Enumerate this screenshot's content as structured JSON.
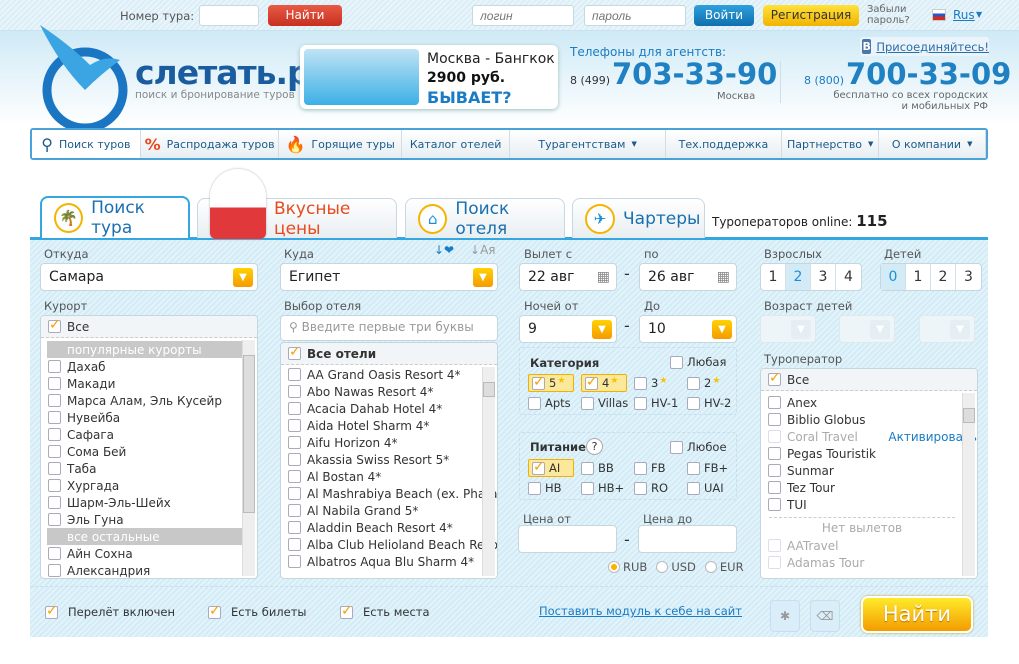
{
  "topbar": {
    "tour_number_label": "Номер тура:",
    "find_label": "Найти",
    "login_placeholder": "логин",
    "password_placeholder": "пароль",
    "login_button": "Войти",
    "register_button": "Регистрация",
    "forgot_line1": "Забыли",
    "forgot_line2": "пароль?",
    "language": "Rus"
  },
  "header": {
    "logo_text": "слетать.ру",
    "logo_subtitle": "поиск и бронирование туров",
    "banner": {
      "route": "Москва - Бангкок",
      "price": "2900 руб.",
      "slogan": "БЫВАЕТ?"
    },
    "phones_label": "Телефоны для агентств:",
    "phone1_code": "8 (499)",
    "phone1": "703-33-90",
    "phone1_city": "Москва",
    "phone2_code": "8 (800)",
    "phone2": "700-33-09",
    "phone2_note1": "бесплатно со всех городских",
    "phone2_note2": "и мобильных РФ",
    "vk_label": "Присоединяйтесь!"
  },
  "nav": [
    {
      "label": "Поиск туров",
      "icon": "search-icon"
    },
    {
      "label": "Распродажа туров",
      "icon": "percent-icon"
    },
    {
      "label": "Горящие туры",
      "icon": "fire-icon"
    },
    {
      "label": "Каталог отелей"
    },
    {
      "label": "Турагентствам",
      "dropdown": true
    },
    {
      "label": "Тех.поддержка"
    },
    {
      "label": "Партнерство",
      "dropdown": true
    },
    {
      "label": "О компании",
      "dropdown": true
    }
  ],
  "tabs": [
    {
      "label": "Поиск тура",
      "active": true
    },
    {
      "label": "Вкусные цены"
    },
    {
      "label": "Поиск отеля"
    },
    {
      "label": "Чартеры"
    }
  ],
  "operators_online_label": "Туроператоров online:",
  "operators_online_count": "115",
  "form": {
    "from_label": "Откуда",
    "from_value": "Самара",
    "to_label": "Куда",
    "to_value": "Египет",
    "sort_alpha": "Ая",
    "resort_label": "Курорт",
    "resort_all": "Все",
    "resort_groups": [
      {
        "title": "популярные курорты",
        "items": [
          "Дахаб",
          "Макади",
          "Марса Алам, Эль Кусейр",
          "Нувейба",
          "Сафага",
          "Сома Бей",
          "Таба",
          "Хургада",
          "Шарм-Эль-Шейх",
          "Эль Гуна"
        ]
      },
      {
        "title": "все остальные",
        "items": [
          "Айн Сохна",
          "Александрия"
        ]
      }
    ],
    "hotel_label": "Выбор отеля",
    "hotel_search_placeholder": "Введите первые три буквы",
    "hotel_all": "Все отели",
    "hotels": [
      "AA Grand Oasis Resort 4*",
      "Abo Nawas Resort 4*",
      "Acacia Dahab Hotel 4*",
      "Aida Hotel Sharm 4*",
      "Aifu Horizon 4*",
      "Akassia Swiss Resort 5*",
      "Al Bostan 4*",
      "Al Mashrabiya Beach (ex. Pharaoh",
      "Al Nabila Grand 5*",
      "Aladdin Beach Resort 4*",
      "Alba Club Helioland Beach Resort",
      "Albatros Aqua Blu Sharm 4*"
    ],
    "depart_from_label": "Вылет с",
    "depart_from": "22 авг",
    "depart_to_label": "по",
    "depart_to": "26 авг",
    "nights_from_label": "Ночей от",
    "nights_from": "9",
    "nights_to_label": "До",
    "nights_to": "10",
    "adults_label": "Взрослых",
    "adults_options": [
      "1",
      "2",
      "3",
      "4"
    ],
    "adults_selected": "2",
    "children_label": "Детей",
    "children_options": [
      "0",
      "1",
      "2",
      "3"
    ],
    "children_selected": "0",
    "children_age_label": "Возраст детей",
    "category_label": "Категория",
    "category_any": "Любая",
    "categories": [
      {
        "label": "5",
        "star": true,
        "checked": true
      },
      {
        "label": "4",
        "star": true,
        "checked": true
      },
      {
        "label": "3",
        "star": true
      },
      {
        "label": "2",
        "star": true
      },
      {
        "label": "Apts"
      },
      {
        "label": "Villas"
      },
      {
        "label": "HV-1"
      },
      {
        "label": "HV-2"
      }
    ],
    "meal_label": "Питание",
    "meal_help": "?",
    "meal_any": "Любое",
    "meals": [
      {
        "label": "AI",
        "checked": true
      },
      {
        "label": "BB"
      },
      {
        "label": "FB"
      },
      {
        "label": "FB+"
      },
      {
        "label": "HB"
      },
      {
        "label": "HB+"
      },
      {
        "label": "RO"
      },
      {
        "label": "UAI"
      }
    ],
    "price_from_label": "Цена от",
    "price_to_label": "Цена до",
    "currencies": [
      "RUB",
      "USD",
      "EUR"
    ],
    "currency_selected": "RUB",
    "operator_label": "Туроператор",
    "operator_all": "Все",
    "operators": [
      {
        "name": "Anex"
      },
      {
        "name": "Biblio Globus"
      },
      {
        "name": "Coral Travel",
        "disabled": true,
        "action": "Активировать"
      },
      {
        "name": "Pegas Touristik"
      },
      {
        "name": "Sunmar"
      },
      {
        "name": "Tez Tour"
      },
      {
        "name": "TUI"
      }
    ],
    "no_flights_label": "Нет вылетов",
    "operators_no_flights": [
      "AATravel",
      "Adamas Tour"
    ],
    "flight_included": "Перелёт включен",
    "tickets_available": "Есть билеты",
    "seats_available": "Есть места",
    "embed_link": "Поставить модуль к себе на сайт",
    "search_button": "Найти"
  },
  "colors": {
    "accent": "#34a6e0",
    "find_red": "#d9402f",
    "login_blue": "#1784c5",
    "register_yellow": "#f7c600",
    "search_orange": "#f39c00"
  }
}
